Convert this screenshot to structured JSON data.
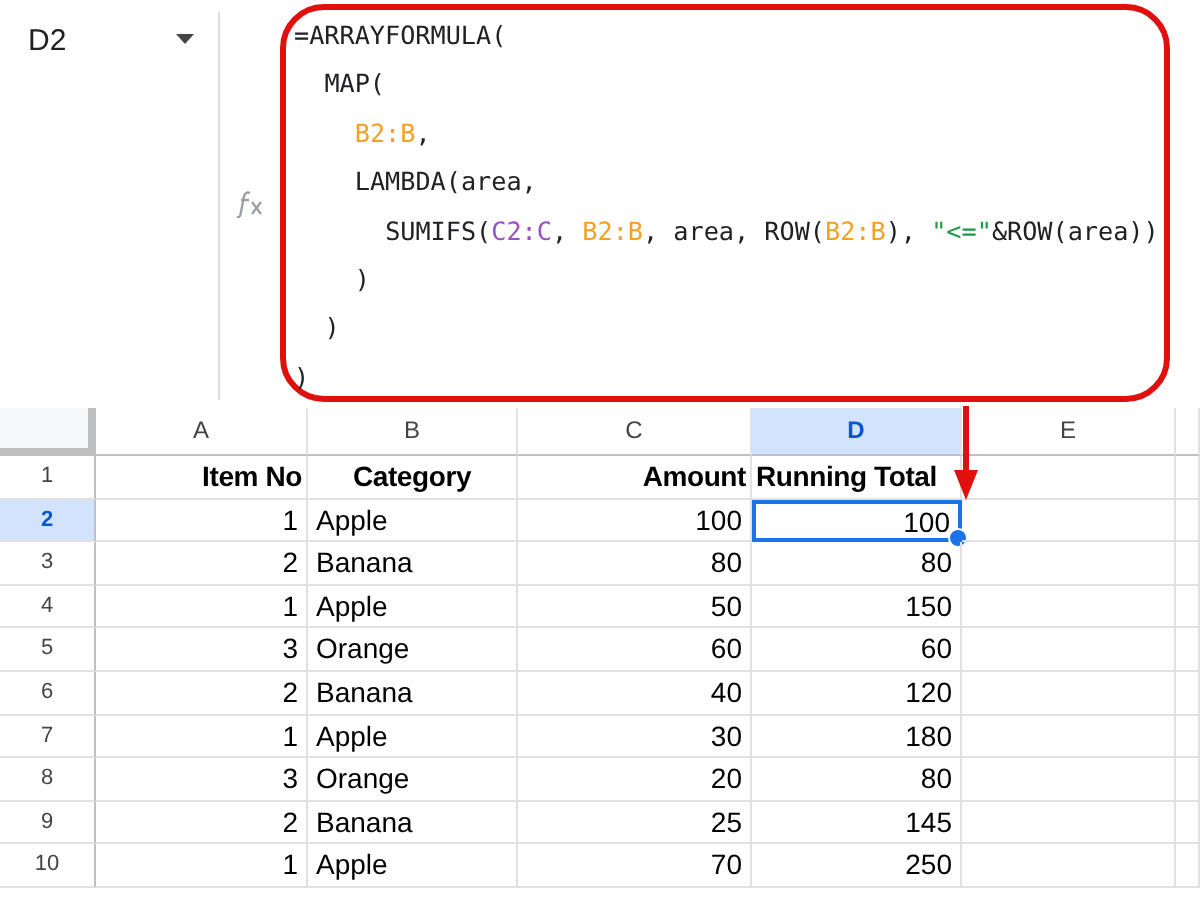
{
  "name_box": {
    "value": "D2"
  },
  "formula_bar": {
    "lines": [
      {
        "segments": [
          {
            "text": "=ARRAYFORMULA("
          }
        ],
        "children": [
          {
            "segments": [
              {
                "text": "MAP("
              }
            ],
            "children": [
              {
                "segments": [
                  {
                    "text": "B2:B",
                    "color": "#f4a025"
                  },
                  {
                    "text": ","
                  }
                ]
              },
              {
                "segments": [
                  {
                    "text": "LAMBDA(area,"
                  }
                ],
                "children": [
                  {
                    "segments": [
                      {
                        "text": "SUMIFS("
                      },
                      {
                        "text": "C2:C",
                        "color": "#9b4fc0"
                      },
                      {
                        "text": ", "
                      },
                      {
                        "text": "B2:B",
                        "color": "#f4a025"
                      },
                      {
                        "text": ", area, ROW("
                      },
                      {
                        "text": "B2:B",
                        "color": "#f4a025"
                      },
                      {
                        "text": "), "
                      },
                      {
                        "text": "\"<=\"",
                        "color": "#1e9a4b"
                      },
                      {
                        "text": "&ROW(area))"
                      }
                    ]
                  }
                ]
              },
              {
                "segments": [
                  {
                    "text": ")"
                  }
                ]
              }
            ]
          },
          {
            "segments": [
              {
                "text": ")"
              }
            ]
          }
        ]
      },
      {
        "segments": [
          {
            "text": ")"
          }
        ]
      }
    ]
  },
  "columns": [
    {
      "label": "A",
      "selected": false
    },
    {
      "label": "B",
      "selected": false
    },
    {
      "label": "C",
      "selected": false
    },
    {
      "label": "D",
      "selected": true
    },
    {
      "label": "E",
      "selected": false
    }
  ],
  "rows": [
    {
      "number": "1",
      "selected": false,
      "header": true,
      "cells": [
        "Item No",
        "Category",
        "Amount",
        "Running Total",
        ""
      ]
    },
    {
      "number": "2",
      "selected": true,
      "header": false,
      "cells": [
        "1",
        "Apple",
        "100",
        "100",
        ""
      ]
    },
    {
      "number": "3",
      "selected": false,
      "header": false,
      "cells": [
        "2",
        "Banana",
        "80",
        "80",
        ""
      ]
    },
    {
      "number": "4",
      "selected": false,
      "header": false,
      "cells": [
        "1",
        "Apple",
        "50",
        "150",
        ""
      ]
    },
    {
      "number": "5",
      "selected": false,
      "header": false,
      "cells": [
        "3",
        "Orange",
        "60",
        "60",
        ""
      ]
    },
    {
      "number": "6",
      "selected": false,
      "header": false,
      "cells": [
        "2",
        "Banana",
        "40",
        "120",
        ""
      ]
    },
    {
      "number": "7",
      "selected": false,
      "header": false,
      "cells": [
        "1",
        "Apple",
        "30",
        "180",
        ""
      ]
    },
    {
      "number": "8",
      "selected": false,
      "header": false,
      "cells": [
        "3",
        "Orange",
        "20",
        "80",
        ""
      ]
    },
    {
      "number": "9",
      "selected": false,
      "header": false,
      "cells": [
        "2",
        "Banana",
        "25",
        "145",
        ""
      ]
    },
    {
      "number": "10",
      "selected": false,
      "header": false,
      "cells": [
        "1",
        "Apple",
        "70",
        "250",
        ""
      ]
    }
  ]
}
